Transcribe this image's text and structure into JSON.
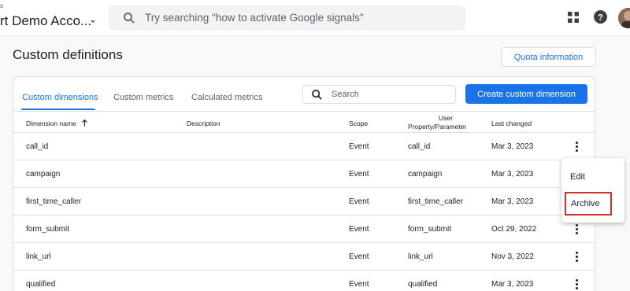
{
  "topbar": {
    "account_small": "s",
    "account_name": "rt Demo Acco...",
    "search_placeholder": "Try searching \"how to activate Google signals\""
  },
  "page": {
    "title": "Custom definitions",
    "quota_button": "Quota information"
  },
  "tabs": [
    "Custom dimensions",
    "Custom metrics",
    "Calculated metrics"
  ],
  "active_tab": "Custom dimensions",
  "table_search_placeholder": "Search",
  "create_button": "Create custom dimension",
  "columns": {
    "name": "Dimension name",
    "description": "Description",
    "scope": "Scope",
    "user_property_1": "User",
    "user_property_2": "Property/Parameter",
    "last_changed": "Last changed"
  },
  "rows": [
    {
      "name": "call_id",
      "description": "",
      "scope": "Event",
      "property": "call_id",
      "last_changed": "Mar 3, 2023"
    },
    {
      "name": "campaign",
      "description": "",
      "scope": "Event",
      "property": "campaign",
      "last_changed": "Mar 3, 2023"
    },
    {
      "name": "first_time_caller",
      "description": "",
      "scope": "Event",
      "property": "first_time_caller",
      "last_changed": "Mar 3, 2023"
    },
    {
      "name": "form_submit",
      "description": "",
      "scope": "Event",
      "property": "form_submit",
      "last_changed": "Oct 29, 2022"
    },
    {
      "name": "link_url",
      "description": "",
      "scope": "Event",
      "property": "link_url",
      "last_changed": "Nov 3, 2022"
    },
    {
      "name": "qualified",
      "description": "",
      "scope": "Event",
      "property": "qualified",
      "last_changed": "Mar 3, 2023"
    }
  ],
  "menu": {
    "edit": "Edit",
    "archive": "Archive"
  },
  "colors": {
    "accent": "#1a73e8",
    "highlight_border": "#d93025"
  }
}
